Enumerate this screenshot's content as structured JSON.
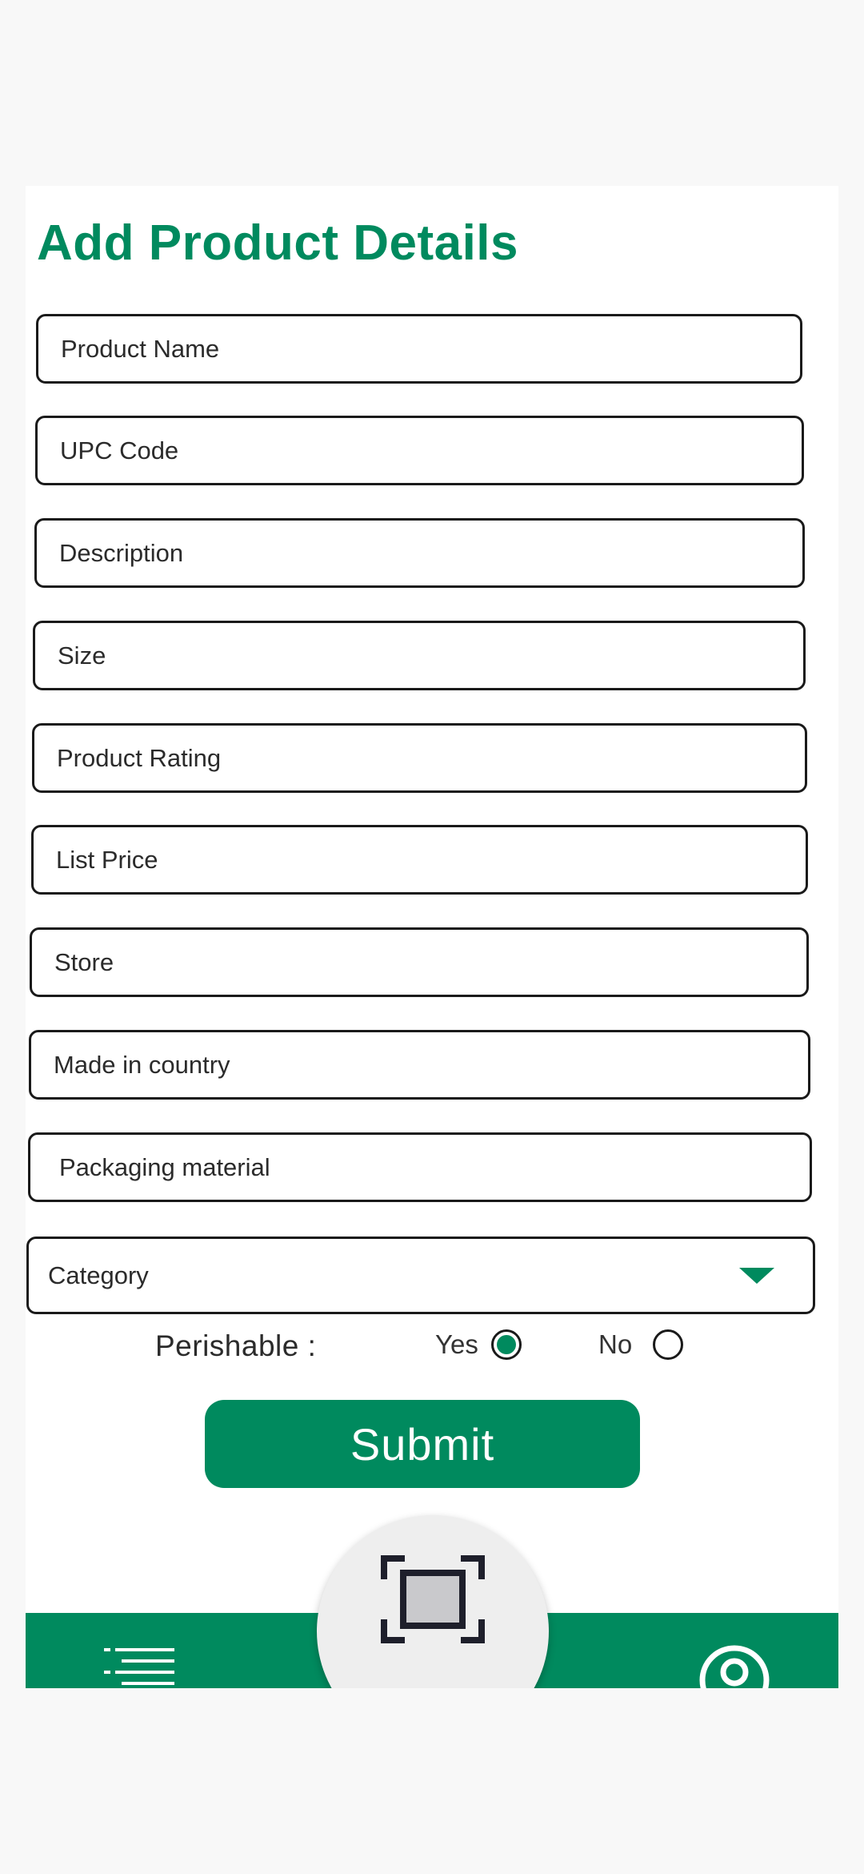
{
  "form": {
    "title": "Add Product Details",
    "fields": {
      "product_name": "Product Name",
      "upc_code": "UPC Code",
      "description": "Description",
      "size": "Size",
      "product_rating": "Product Rating",
      "list_price": "List Price",
      "store": "Store",
      "made_in_country": "Made in country",
      "packaging_material": "Packaging material"
    },
    "category": {
      "selected": "Category",
      "icon": "caret-down-icon"
    },
    "perishable": {
      "label": "Perishable :",
      "yes_label": "Yes",
      "no_label": "No",
      "selected": "Yes"
    },
    "submit_label": "Submit"
  },
  "bottom_nav": {
    "left_icon": "menu-list-icon",
    "center_icon": "scan-icon",
    "right_icon": "profile-icon"
  },
  "colors": {
    "accent": "#008a5e",
    "background": "#f8f8f8",
    "card": "#ffffff"
  }
}
